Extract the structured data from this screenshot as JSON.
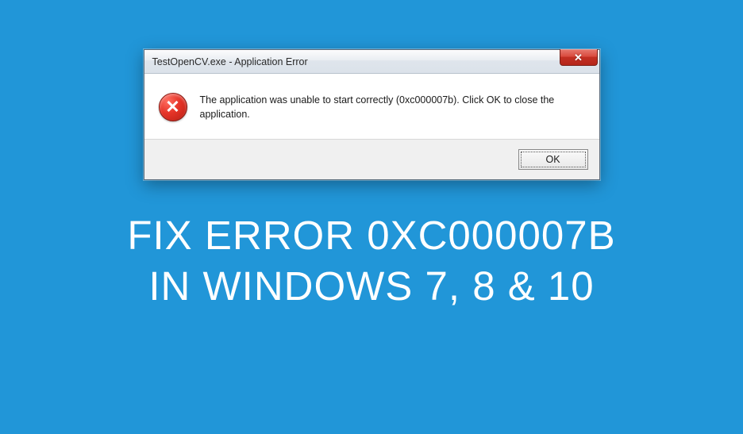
{
  "dialog": {
    "title": "TestOpenCV.exe - Application Error",
    "message": "The application was unable to start correctly (0xc000007b). Click OK to close the application.",
    "ok_label": "OK"
  },
  "headline": {
    "line1": "FIX ERROR 0XC000007B",
    "line2": "IN WINDOWS 7, 8 & 10"
  }
}
